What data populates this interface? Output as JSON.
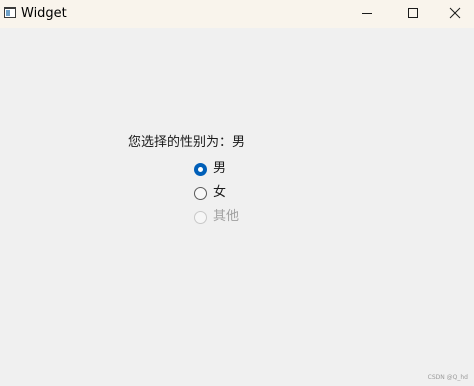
{
  "window": {
    "title": "Widget",
    "app_icon": "window-app-icon",
    "controls": {
      "minimize_icon": "minimize-icon",
      "maximize_icon": "maximize-icon",
      "close_icon": "close-icon"
    },
    "titlebar_color": "#f9f4ec",
    "background_color": "#f0f0f0"
  },
  "main": {
    "selection_label": "您选择的性别为：男",
    "radios": [
      {
        "label": "男",
        "checked": true,
        "enabled": true
      },
      {
        "label": "女",
        "checked": false,
        "enabled": true
      },
      {
        "label": "其他",
        "checked": false,
        "enabled": false
      }
    ],
    "accent_color": "#005fb8"
  },
  "watermark": "CSDN @Q_hd"
}
